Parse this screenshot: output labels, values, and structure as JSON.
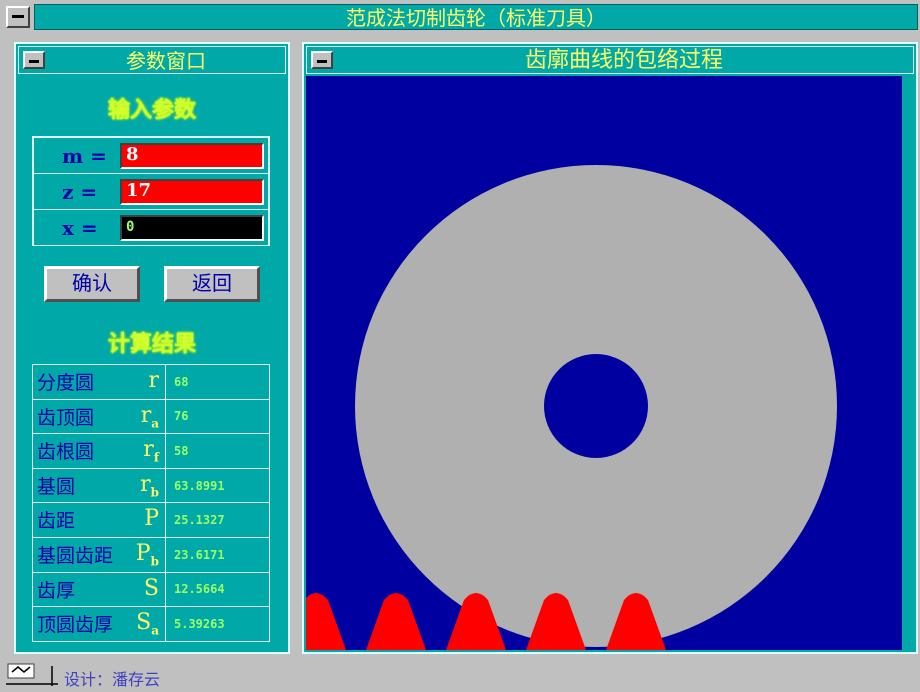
{
  "window": {
    "title": "范成法切制齿轮（标准刀具）"
  },
  "params_panel": {
    "title": "参数窗口",
    "input_heading": "输入参数",
    "fields": [
      {
        "label": "m =",
        "value": "8",
        "bg": "#ff0000"
      },
      {
        "label": "z =",
        "value": "17",
        "bg": "#ff0000"
      },
      {
        "label": "x =",
        "value": "0",
        "bg": "#000000"
      }
    ],
    "confirm_label": "确认",
    "back_label": "返回",
    "result_heading": "计算结果",
    "results": [
      {
        "name": "分度圆",
        "sym": "r",
        "sub": "",
        "value": "68"
      },
      {
        "name": "齿顶圆",
        "sym": "r",
        "sub": "a",
        "value": "76"
      },
      {
        "name": "齿根圆",
        "sym": "r",
        "sub": "f",
        "value": "58"
      },
      {
        "name": "基圆",
        "sym": "r",
        "sub": "b",
        "value": "63.8991"
      },
      {
        "name": "齿距",
        "sym": "P",
        "sub": "",
        "value": "25.1327"
      },
      {
        "name": "基圆齿距",
        "sym": "P",
        "sub": "b",
        "value": "23.6171"
      },
      {
        "name": "齿厚",
        "sym": "S",
        "sub": "",
        "value": "12.5664"
      },
      {
        "name": "顶圆齿厚",
        "sym": "S",
        "sub": "a",
        "value": "5.39263"
      }
    ]
  },
  "canvas_panel": {
    "title": "齿廓曲线的包络过程",
    "colors": {
      "background": "#0000a0",
      "blank": "#b0b0b0",
      "cutter": "#ff0000"
    }
  },
  "footer": {
    "credit": "设计：潘存云"
  }
}
